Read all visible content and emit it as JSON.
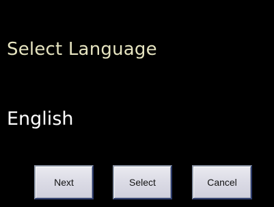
{
  "screen": {
    "title": "Select Language",
    "selected_language": "English"
  },
  "buttons": {
    "next_label": "Next",
    "select_label": "Select",
    "cancel_label": "Cancel"
  },
  "colors": {
    "background": "#000000",
    "title_text": "#e6e4c0",
    "value_text": "#ffffff",
    "button_face": "#dcdce6"
  }
}
